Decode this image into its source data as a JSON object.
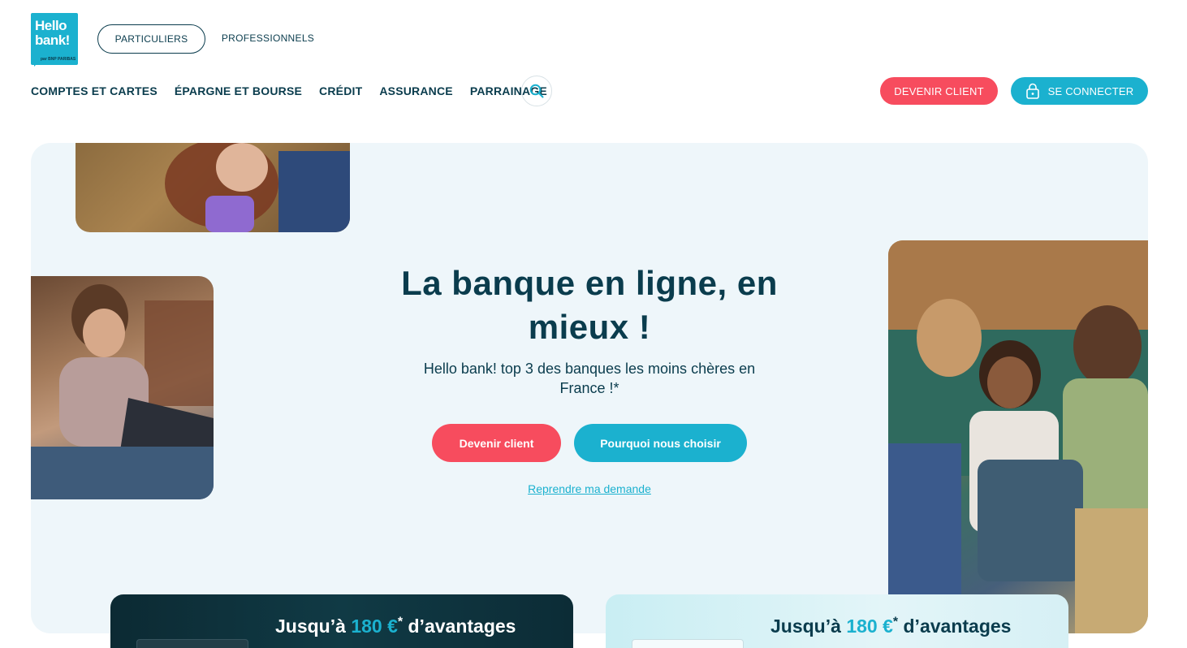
{
  "logo": {
    "line1": "Hello",
    "line2": "bank!",
    "tagline": "par BNP PARIBAS"
  },
  "segments": {
    "active": "PARTICULIERS",
    "other": "PROFESSIONNELS"
  },
  "nav": {
    "items": [
      {
        "label": "COMPTES ET CARTES"
      },
      {
        "label": "ÉPARGNE ET BOURSE"
      },
      {
        "label": "CRÉDIT"
      },
      {
        "label": "ASSURANCE"
      },
      {
        "label": "PARRAINAGE"
      }
    ],
    "search_icon": "search-icon"
  },
  "header_actions": {
    "become_client": "DEVENIR CLIENT",
    "connect": "SE CONNECTER",
    "connect_icon": "lock-icon"
  },
  "hero": {
    "title": "La banque en ligne, en mieux !",
    "subtitle": "Hello bank! top 3 des banques les moins chères en France !*",
    "cta_primary": "Devenir client",
    "cta_secondary": "Pourquoi nous choisir",
    "resume_link": "Reprendre ma demande"
  },
  "offers": [
    {
      "prefix": "Jusqu’à",
      "amount": "180 €",
      "star": "*",
      "suffix": "d’avantages"
    },
    {
      "prefix": "Jusqu’à",
      "amount": "180 €",
      "star": "*",
      "suffix": "d’avantages"
    }
  ],
  "colors": {
    "brand_blue": "#1bb1cf",
    "brand_red": "#f74c5e",
    "navy": "#0a3c4d",
    "hero_bg": "#eef6fa"
  }
}
